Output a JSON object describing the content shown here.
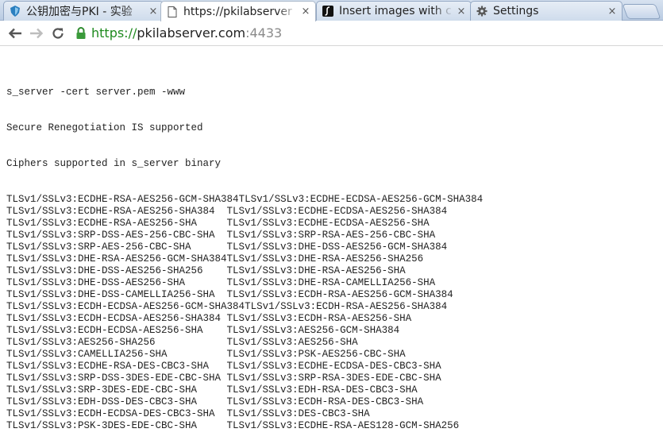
{
  "tabs": [
    {
      "title": "公钥加密与PKI - 实验",
      "favicon": "shield-icon",
      "active": false
    },
    {
      "title": "https://pkilabserver",
      "favicon": "page-icon",
      "active": true
    },
    {
      "title": "Insert images with c",
      "favicon": "italic-s-icon",
      "active": false
    },
    {
      "title": "Settings",
      "favicon": "gear-icon",
      "active": false
    }
  ],
  "tab_close_glyph": "×",
  "address_bar": {
    "scheme": "https://",
    "host": "pkilabserver.com",
    "port": ":4433",
    "secure_color": "#1e8a1e"
  },
  "page": {
    "lines": [
      "s_server -cert server.pem -www",
      "Secure Renegotiation IS supported",
      "Ciphers supported in s_server binary"
    ],
    "cipher_rows": [
      [
        "TLSv1/SSLv3:ECDHE-RSA-AES256-GCM-SHA384",
        "TLSv1/SSLv3:ECDHE-ECDSA-AES256-GCM-SHA384"
      ],
      [
        "TLSv1/SSLv3:ECDHE-RSA-AES256-SHA384  ",
        "TLSv1/SSLv3:ECDHE-ECDSA-AES256-SHA384"
      ],
      [
        "TLSv1/SSLv3:ECDHE-RSA-AES256-SHA     ",
        "TLSv1/SSLv3:ECDHE-ECDSA-AES256-SHA"
      ],
      [
        "TLSv1/SSLv3:SRP-DSS-AES-256-CBC-SHA  ",
        "TLSv1/SSLv3:SRP-RSA-AES-256-CBC-SHA"
      ],
      [
        "TLSv1/SSLv3:SRP-AES-256-CBC-SHA      ",
        "TLSv1/SSLv3:DHE-DSS-AES256-GCM-SHA384"
      ],
      [
        "TLSv1/SSLv3:DHE-RSA-AES256-GCM-SHA384",
        "TLSv1/SSLv3:DHE-RSA-AES256-SHA256"
      ],
      [
        "TLSv1/SSLv3:DHE-DSS-AES256-SHA256    ",
        "TLSv1/SSLv3:DHE-RSA-AES256-SHA"
      ],
      [
        "TLSv1/SSLv3:DHE-DSS-AES256-SHA       ",
        "TLSv1/SSLv3:DHE-RSA-CAMELLIA256-SHA"
      ],
      [
        "TLSv1/SSLv3:DHE-DSS-CAMELLIA256-SHA  ",
        "TLSv1/SSLv3:ECDH-RSA-AES256-GCM-SHA384"
      ],
      [
        "TLSv1/SSLv3:ECDH-ECDSA-AES256-GCM-SHA384",
        "TLSv1/SSLv3:ECDH-RSA-AES256-SHA384"
      ],
      [
        "TLSv1/SSLv3:ECDH-ECDSA-AES256-SHA384 ",
        "TLSv1/SSLv3:ECDH-RSA-AES256-SHA"
      ],
      [
        "TLSv1/SSLv3:ECDH-ECDSA-AES256-SHA    ",
        "TLSv1/SSLv3:AES256-GCM-SHA384"
      ],
      [
        "TLSv1/SSLv3:AES256-SHA256            ",
        "TLSv1/SSLv3:AES256-SHA"
      ],
      [
        "TLSv1/SSLv3:CAMELLIA256-SHA          ",
        "TLSv1/SSLv3:PSK-AES256-CBC-SHA"
      ],
      [
        "TLSv1/SSLv3:ECDHE-RSA-DES-CBC3-SHA   ",
        "TLSv1/SSLv3:ECDHE-ECDSA-DES-CBC3-SHA"
      ],
      [
        "TLSv1/SSLv3:SRP-DSS-3DES-EDE-CBC-SHA ",
        "TLSv1/SSLv3:SRP-RSA-3DES-EDE-CBC-SHA"
      ],
      [
        "TLSv1/SSLv3:SRP-3DES-EDE-CBC-SHA     ",
        "TLSv1/SSLv3:EDH-RSA-DES-CBC3-SHA"
      ],
      [
        "TLSv1/SSLv3:EDH-DSS-DES-CBC3-SHA     ",
        "TLSv1/SSLv3:ECDH-RSA-DES-CBC3-SHA"
      ],
      [
        "TLSv1/SSLv3:ECDH-ECDSA-DES-CBC3-SHA  ",
        "TLSv1/SSLv3:DES-CBC3-SHA"
      ],
      [
        "TLSv1/SSLv3:PSK-3DES-EDE-CBC-SHA     ",
        "TLSv1/SSLv3:ECDHE-RSA-AES128-GCM-SHA256"
      ]
    ]
  }
}
